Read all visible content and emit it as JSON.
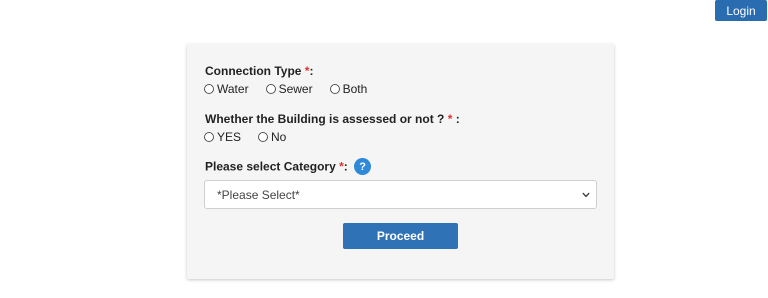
{
  "header": {
    "login_label": "Login"
  },
  "form": {
    "connection_type": {
      "label": "Connection Type",
      "required_mark": "*",
      "suffix": ":",
      "options": [
        "Water",
        "Sewer",
        "Both"
      ]
    },
    "building_assessed": {
      "label": "Whether the Building is assessed or not ?",
      "required_mark": "*",
      "suffix": ":",
      "options": [
        "YES",
        "No"
      ]
    },
    "category": {
      "label": "Please select Category",
      "required_mark": "*",
      "suffix": ":",
      "help_icon": "question-mark-icon",
      "help_glyph": "?",
      "selected_value": "*Please Select*"
    },
    "proceed_label": "Proceed"
  },
  "colors": {
    "primary_button": "#2f72b5",
    "login_button": "#2a6cb0",
    "required_mark": "#e0312b",
    "help_icon": "#2e8ad8",
    "card_background": "#f5f5f5"
  }
}
